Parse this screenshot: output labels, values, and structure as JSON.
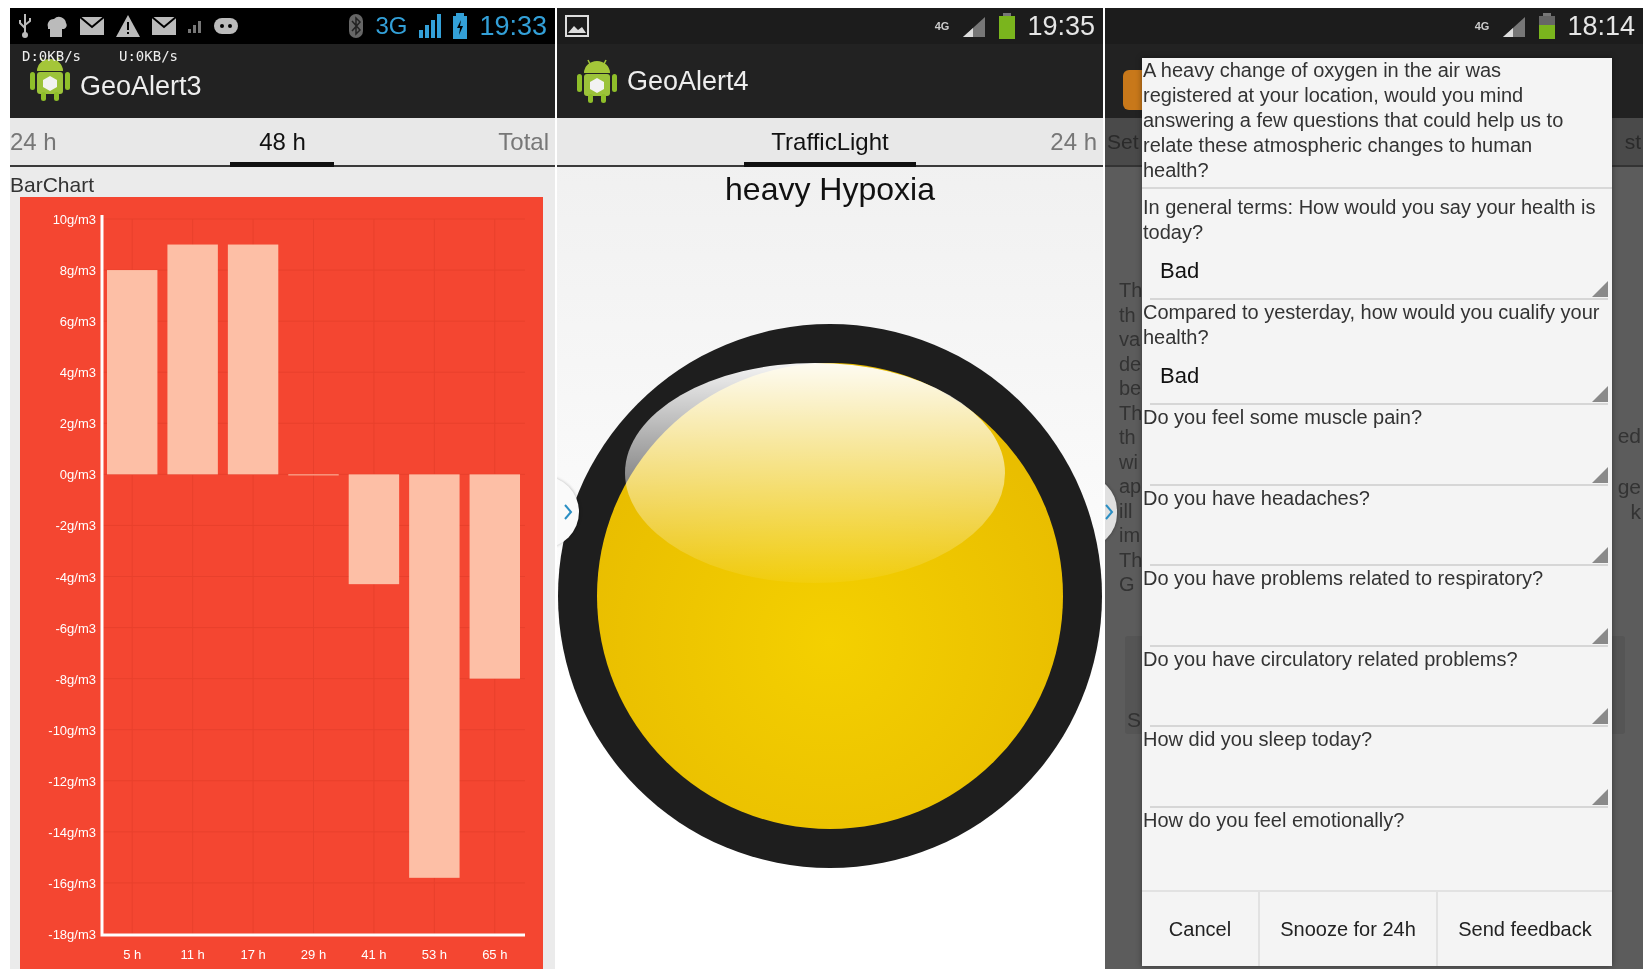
{
  "screen_1": {
    "status_bar": {
      "network": "3G",
      "time": "19:33"
    },
    "net_speed": [
      "D:0KB/s",
      "U:0KB/s"
    ],
    "app_title": "GeoAlert3",
    "tabs": [
      {
        "label": "24 h",
        "selected": false
      },
      {
        "label": "48 h",
        "selected": true
      },
      {
        "label": "Total",
        "selected": false
      }
    ],
    "section_title": "BarChart",
    "chart_data": {
      "type": "bar",
      "categories": [
        "5 h",
        "11 h",
        "17 h",
        "29 h",
        "41 h",
        "53 h",
        "65 h"
      ],
      "values": [
        8,
        9,
        9,
        0,
        -4.3,
        -15.8,
        -8
      ],
      "ylim": [
        -18,
        10
      ],
      "yticks": [
        10,
        8,
        6,
        4,
        2,
        0,
        -2,
        -4,
        -6,
        -8,
        -10,
        -12,
        -14,
        -16,
        -18
      ],
      "ylabel": "g/m3",
      "grid": true
    }
  },
  "screen_2": {
    "status_bar": {
      "network": "4G",
      "time": "19:35"
    },
    "app_title": "GeoAlert4",
    "tabs": [
      {
        "label": "TrafficLight",
        "selected": true
      },
      {
        "label": "24 h",
        "selected": false
      }
    ],
    "headline": "heavy Hypoxia"
  },
  "screen_3": {
    "status_bar": {
      "network": "4G",
      "time": "18:14"
    },
    "background_tabs": [
      "Set",
      "st"
    ],
    "background_text_left": [
      "Th",
      "th",
      "va",
      "de",
      "be",
      "Th",
      "th",
      "wi",
      "ap",
      "ill",
      "im",
      "Th",
      "G"
    ],
    "background_letter": "S",
    "background_text_right": [
      "ed",
      "ge",
      "k"
    ],
    "dialog": {
      "intro": "A heavy change of oxygen in the air was registered at your location, would you mind answering a few questions that could help us to relate these atmospheric changes to human health?",
      "questions": [
        {
          "kind": "dropdown",
          "question": "In general terms: How would you say your health is today?",
          "answer": "Bad"
        },
        {
          "kind": "dropdown",
          "question": "Compared to yesterday, how would you cualify your health?",
          "answer": "Bad"
        },
        {
          "kind": "dropdown",
          "question": "Do you feel some muscle pain?"
        },
        {
          "kind": "dropdown",
          "question": "Do you have headaches?"
        },
        {
          "kind": "dropdown",
          "question": "Do you have problems related to respiratory?"
        },
        {
          "kind": "dropdown",
          "question": "Do you have circulatory related problems?"
        },
        {
          "kind": "dropdown",
          "question": "How did you sleep today?"
        },
        {
          "kind": "label",
          "question": "How do you feel emotionally?"
        }
      ],
      "buttons": [
        "Cancel",
        "Snooze for 24h",
        "Send feedback"
      ]
    }
  }
}
